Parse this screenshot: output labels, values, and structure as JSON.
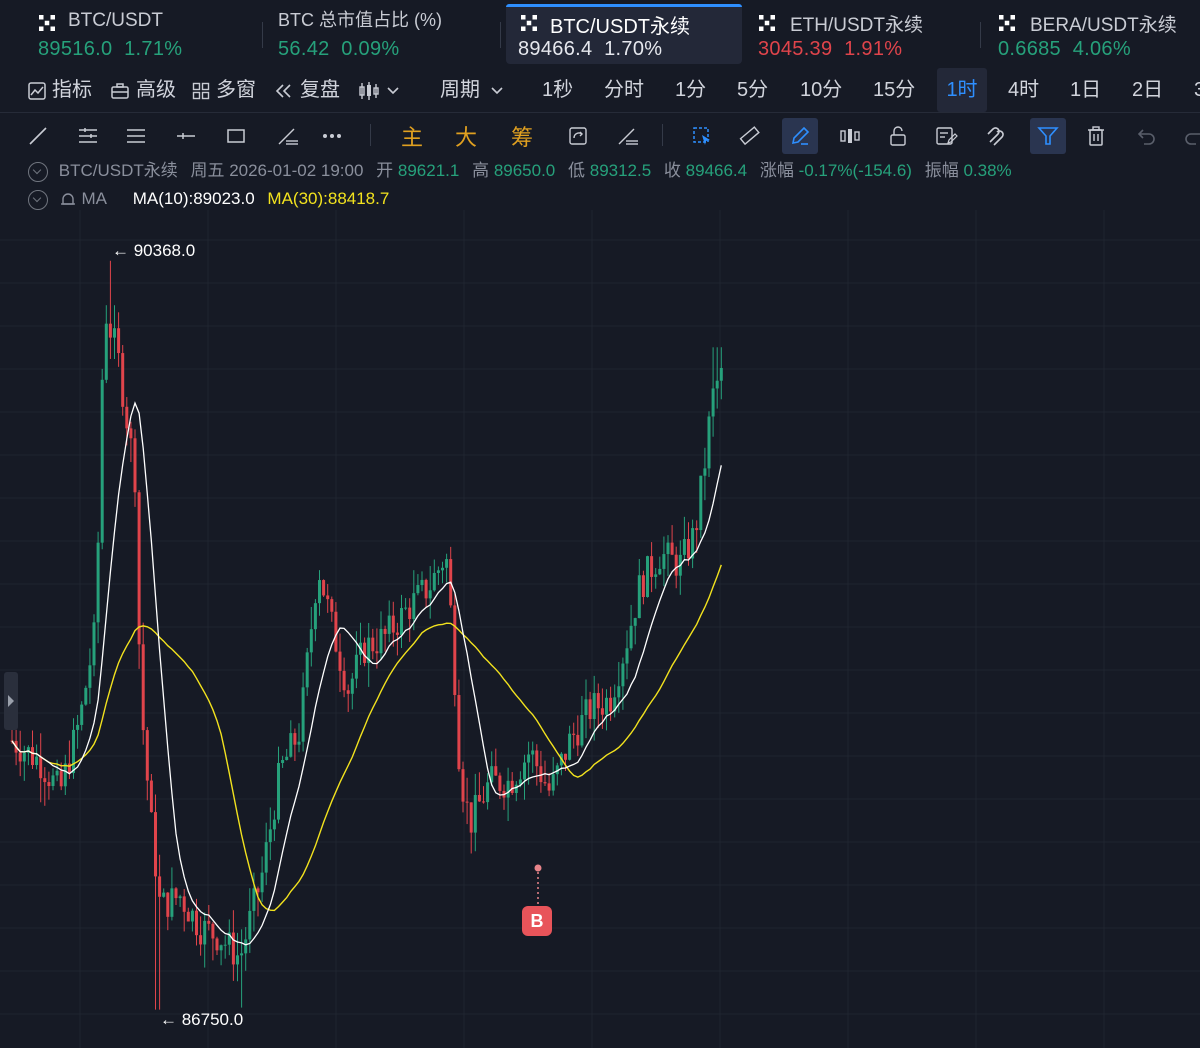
{
  "tabs": [
    {
      "name": "BTC/USDT",
      "price": "89516.0",
      "change": "1.71%",
      "dir": "up",
      "logo": "okx-logo-icon"
    },
    {
      "name": "BTC 总市值占比 (%)",
      "price": "56.42",
      "change": "0.09%",
      "dir": "up",
      "logo": ""
    },
    {
      "name": "BTC/USDT永续",
      "price": "89466.4",
      "change": "1.70%",
      "dir": "up",
      "logo": "okx-logo-icon",
      "active": true
    },
    {
      "name": "ETH/USDT永续",
      "price": "3045.39",
      "change": "1.91%",
      "dir": "down",
      "logo": "okx-logo-icon"
    },
    {
      "name": "BERA/USDT永续",
      "price": "0.6685",
      "change": "4.06%",
      "dir": "up",
      "logo": "okx-logo-icon"
    }
  ],
  "toolbar": {
    "indicators": "指标",
    "advanced": "高级",
    "multi_window": "多窗",
    "replay": "复盘",
    "period": "周期",
    "intervals": [
      "1秒",
      "分时",
      "1分",
      "5分",
      "10分",
      "15分",
      "1时",
      "4时",
      "1日",
      "2日",
      "3"
    ],
    "active_interval": "1时"
  },
  "draw_tools": {
    "main": "主",
    "big": "大",
    "chips": "筹"
  },
  "legend": {
    "symbol": "BTC/USDT永续",
    "datetime": "周五 2026-01-02 19:00",
    "open_label": "开",
    "open": "89621.1",
    "high_label": "高",
    "high": "89650.0",
    "low_label": "低",
    "low": "89312.5",
    "close_label": "收",
    "close": "89466.4",
    "change_label": "涨幅",
    "change": "-0.17%(-154.6)",
    "amp_label": "振幅",
    "amp": "0.38%",
    "ma_label": "MA",
    "ma10": "MA(10):89023.0",
    "ma30": "MA(30):88418.7"
  },
  "chart_data": {
    "type": "candlestick",
    "high_marker": "← 90368.0",
    "low_marker": "← 86750.0",
    "signal_label": "B",
    "colors": {
      "up": "#26a17b",
      "down": "#e0444b",
      "ma10": "#ffffff",
      "ma30": "#f2e21e",
      "bg": "#161a25",
      "grid": "#1f2430"
    },
    "price_range": [
      86700,
      90420
    ],
    "ma10_color_label": "white",
    "ma30_color_label": "yellow"
  }
}
